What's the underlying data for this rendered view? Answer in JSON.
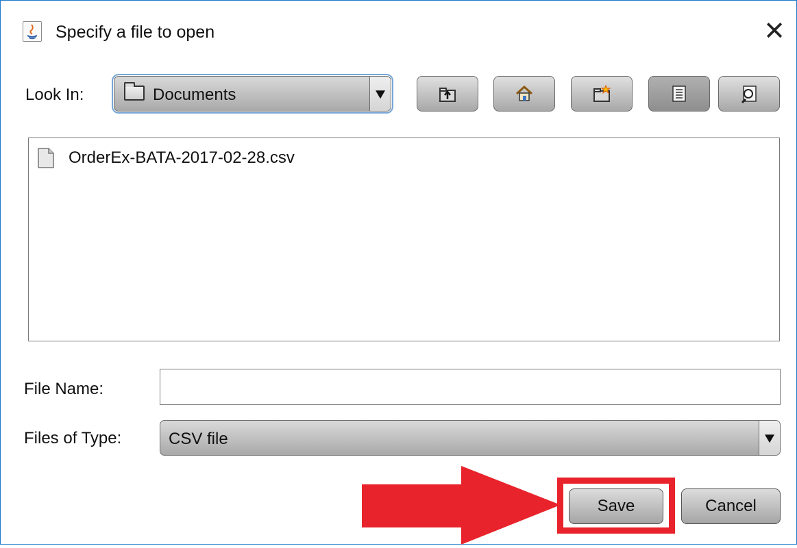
{
  "window": {
    "title": "Specify a file to open",
    "close_glyph": "✕"
  },
  "look_in": {
    "label": "Look In:",
    "value": "Documents"
  },
  "toolbar": {
    "buttons": [
      {
        "icon": "up-one-level-icon"
      },
      {
        "icon": "home-icon"
      },
      {
        "icon": "new-folder-icon"
      },
      {
        "icon": "list-view-icon",
        "pressed": true
      },
      {
        "icon": "details-view-icon"
      }
    ]
  },
  "files": [
    {
      "name": "OrderEx-BATA-2017-02-28.csv",
      "icon": "document-icon"
    }
  ],
  "file_name": {
    "label": "File Name:",
    "value": ""
  },
  "files_of_type": {
    "label": "Files of Type:",
    "value": "CSV file"
  },
  "actions": {
    "save_label": "Save",
    "cancel_label": "Cancel"
  },
  "annotation": {
    "color": "#e8232b"
  }
}
